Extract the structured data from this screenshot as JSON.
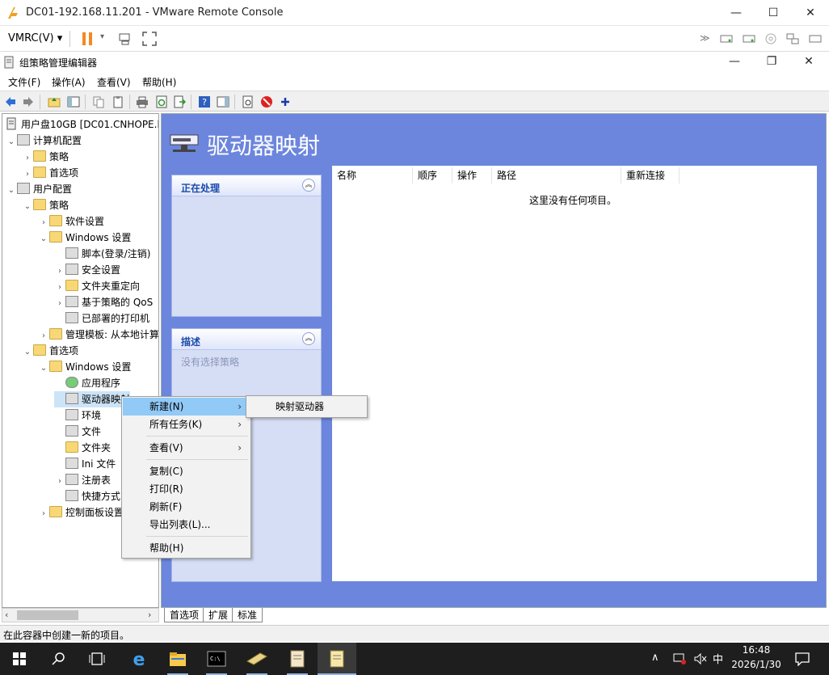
{
  "vm": {
    "title": "DC01-192.168.11.201 - VMware Remote Console",
    "menu": "VMRC(V)"
  },
  "gp": {
    "title": "组策略管理编辑器"
  },
  "menubar": [
    "文件(F)",
    "操作(A)",
    "查看(V)",
    "帮助(H)"
  ],
  "tree": {
    "root": "用户盘10GB [DC01.CNHOPE.l",
    "items": [
      {
        "label": "计算机配置"
      },
      {
        "label": "策略"
      },
      {
        "label": "首选项"
      },
      {
        "label": "用户配置"
      },
      {
        "label": "策略"
      },
      {
        "label": "软件设置"
      },
      {
        "label": "Windows 设置"
      },
      {
        "label": "脚本(登录/注销)"
      },
      {
        "label": "安全设置"
      },
      {
        "label": "文件夹重定向"
      },
      {
        "label": "基于策略的 QoS"
      },
      {
        "label": "已部署的打印机"
      },
      {
        "label": "管理模板: 从本地计算"
      },
      {
        "label": "首选项"
      },
      {
        "label": "Windows 设置"
      },
      {
        "label": "应用程序"
      },
      {
        "label": "驱动器映射"
      },
      {
        "label": "环境"
      },
      {
        "label": "文件"
      },
      {
        "label": "文件夹"
      },
      {
        "label": "Ini 文件"
      },
      {
        "label": "注册表"
      },
      {
        "label": "快捷方式"
      },
      {
        "label": "控制面板设置"
      }
    ]
  },
  "right": {
    "title": "驱动器映射",
    "processing_header": "正在处理",
    "description_header": "描述",
    "description_text": "没有选择策略",
    "columns": [
      "名称",
      "顺序",
      "操作",
      "路径",
      "重新连接"
    ],
    "empty_text": "这里没有任何项目。"
  },
  "tabs": [
    "首选项",
    "扩展",
    "标准"
  ],
  "status": "在此容器中创建一新的项目。",
  "context_menu": {
    "items": [
      "新建(N)",
      "所有任务(K)",
      "查看(V)",
      "复制(C)",
      "打印(R)",
      "刷新(F)",
      "导出列表(L)...",
      "帮助(H)"
    ]
  },
  "submenu": {
    "items": [
      "映射驱动器"
    ]
  },
  "taskbar": {
    "time": "16:48",
    "date": "2026/1/30",
    "ime": "中"
  },
  "colors": {
    "panel_blue": "#6c86dd",
    "menu_highlight": "#91c9f7"
  }
}
